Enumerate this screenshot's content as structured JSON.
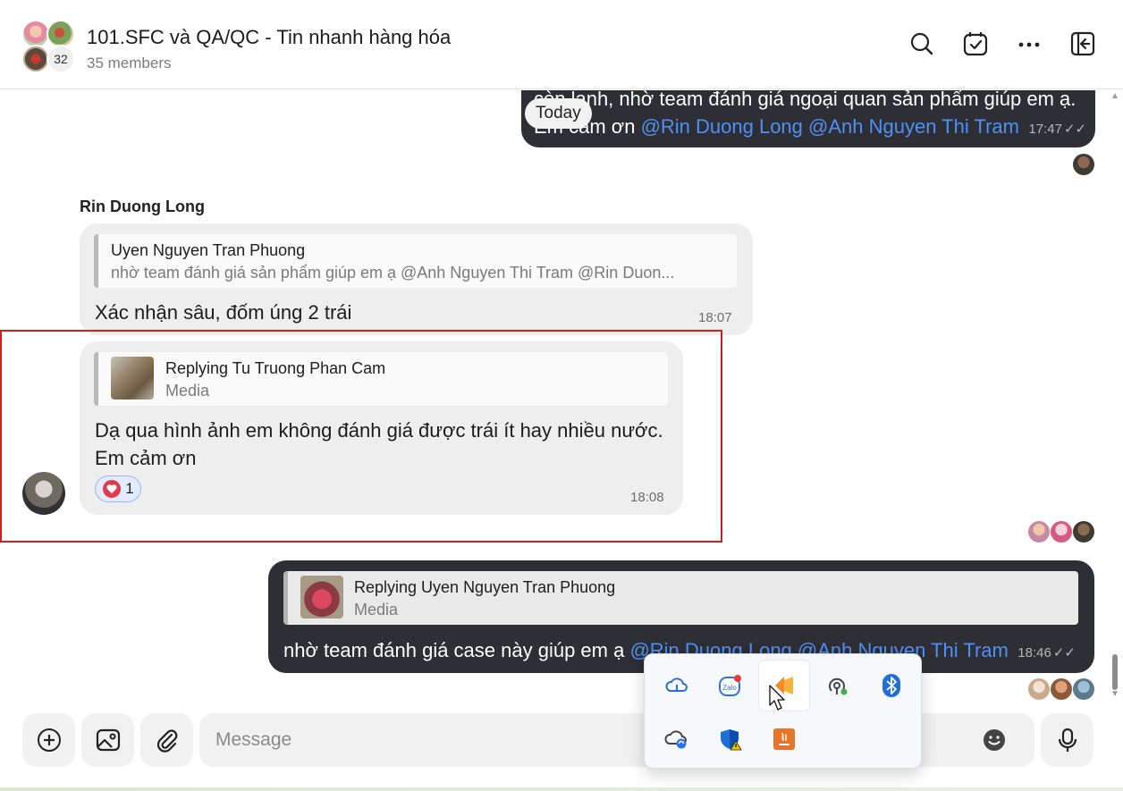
{
  "header": {
    "title": "101.SFC và QA/QC - Tin nhanh hàng hóa",
    "members": "35 members",
    "avatar_count": "32"
  },
  "chat": {
    "msg_top": {
      "line1": "còn lạnh, nhờ team đánh giá ngoại quan sản phẩm giúp em ạ.",
      "prefix": "Em cảm ơn ",
      "mention1": "@Rin Duong Long",
      "mention2": "@Anh Nguyen Thi Tram",
      "time": "17:47",
      "check": "✓✓"
    },
    "today_label": "Today",
    "sender_name": "Rin Duong Long",
    "msg_rin1": {
      "quote_name": "Uyen Nguyen Tran Phuong",
      "quote_text": "nhờ team đánh giá sản phẩm giúp em ạ @Anh Nguyen Thi Tram @Rin Duon...",
      "text": "Xác nhận sâu, đốm úng 2 trái",
      "time": "18:07"
    },
    "msg_rin2": {
      "quote_name": "Replying Tu Truong Phan Cam",
      "quote_sub": "Media",
      "line1": "Dạ qua hình ảnh em không đánh giá được trái ít hay nhiều nước.",
      "line2": "Em cảm ơn",
      "reaction_count": "1",
      "time": "18:08"
    },
    "msg_me": {
      "quote_name": "Replying Uyen Nguyen Tran Phuong",
      "quote_sub": "Media",
      "prefix": "nhờ team đánh giá case này giúp em ạ ",
      "mention1": "@Rin Duong Long",
      "mention2": "@Anh Nguyen Thi Tram",
      "time": "18:46",
      "check": "✓✓"
    }
  },
  "composer": {
    "placeholder": "Message"
  },
  "tray": {
    "icons": [
      "onedrive-icon",
      "zalo-icon",
      "app-icon",
      "hotspot-icon",
      "bluetooth-icon",
      "onedrive-sync-icon",
      "windows-security-icon",
      "java-icon"
    ]
  },
  "colors": {
    "dark_bubble": "#2e2f34",
    "light_bubble": "#eeeeee",
    "mention": "#4f8ff7",
    "highlight": "#d0201e"
  }
}
